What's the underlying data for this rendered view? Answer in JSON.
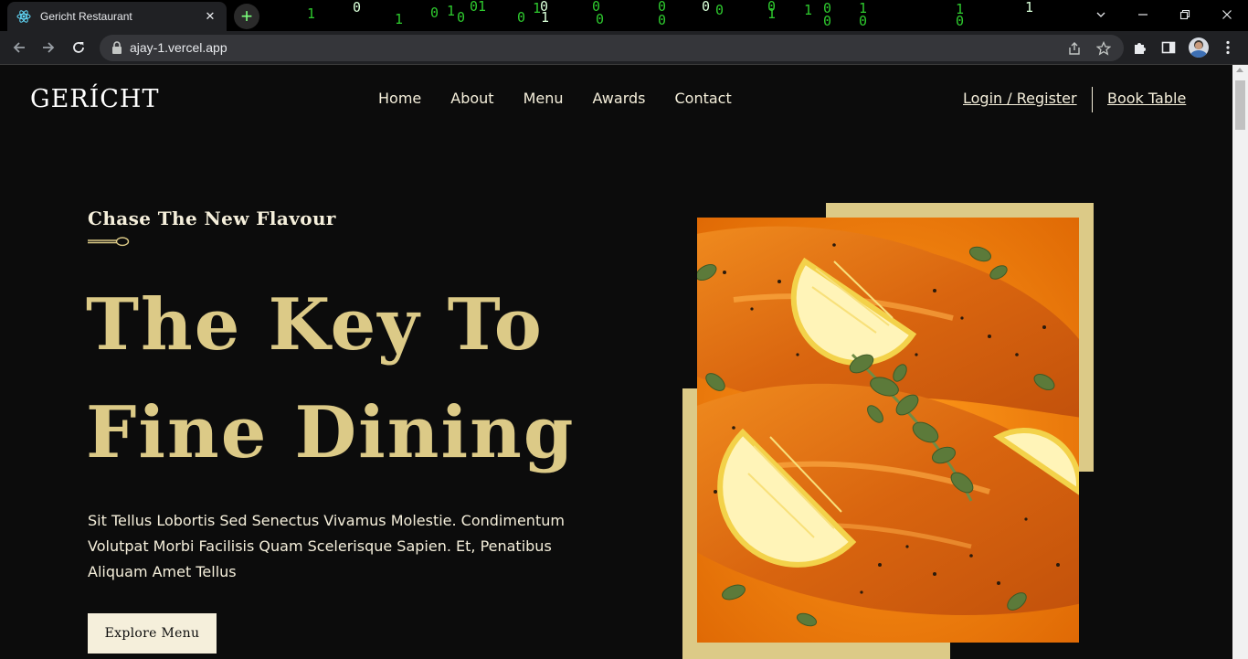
{
  "browser": {
    "tab_title": "Gericht Restaurant",
    "url": "ajay-1.vercel.app",
    "new_tab_symbol": "+",
    "close_symbol": "✕"
  },
  "site": {
    "logo": "GERÍCHT",
    "nav": [
      "Home",
      "About",
      "Menu",
      "Awards",
      "Contact"
    ],
    "auth_link": "Login / Register",
    "book_link": "Book Table"
  },
  "hero": {
    "subtitle": "Chase The New Flavour",
    "headline_line1": "The Key To",
    "headline_line2": "Fine Dining",
    "description": "Sit Tellus Lobortis Sed Senectus Vivamus Molestie. Condimentum Volutpat Morbi Facilisis Quam Scelerisque Sapien. Et, Penatibus Aliquam Amet Tellus",
    "cta": "Explore Menu"
  },
  "colors": {
    "page_bg": "#0c0c0c",
    "golden": "#dcca87",
    "crimson_cream": "#f5efdb",
    "matrix_green": "#2ec92e"
  },
  "icons": {
    "back": "arrow-left-icon",
    "forward": "arrow-right-icon",
    "reload": "reload-icon",
    "lock": "lock-icon",
    "share": "share-icon",
    "bookmark": "star-icon",
    "extensions": "puzzle-icon",
    "side_panel": "side-panel-icon",
    "menu": "kebab-menu-icon"
  }
}
